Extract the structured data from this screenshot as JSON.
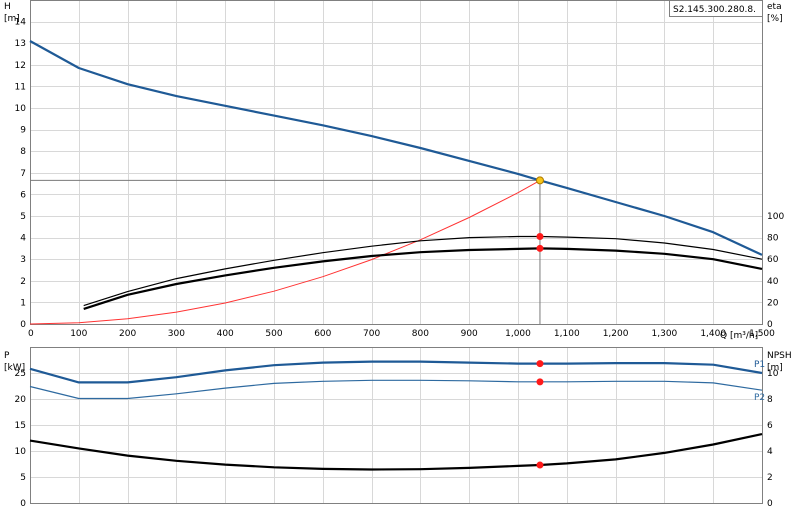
{
  "pump_id": "S2.145.300.280.8.",
  "colors": {
    "head": "#1f5a96",
    "efficiency": "#000000",
    "system_curve": "#ff3333",
    "duty_marker": "#ff1a1a",
    "duty_head_marker": "#f5c518",
    "p1": "#1f5a96",
    "p2": "#2e6aa0",
    "npsh": "#000000"
  },
  "chart_data": [
    {
      "type": "line",
      "ylabel_left": [
        "H",
        "[m]"
      ],
      "ylabel_right": [
        "eta",
        "[%]"
      ],
      "xlabel": "Q [m³/h]",
      "xlim": [
        0,
        1500
      ],
      "ylim": [
        0,
        15
      ],
      "xticks": [
        0,
        100,
        200,
        300,
        400,
        500,
        600,
        700,
        800,
        900,
        1000,
        1100,
        1200,
        1300,
        1400,
        1500
      ],
      "xtick_labels": [
        "0",
        "100",
        "200",
        "300",
        "400",
        "500",
        "600",
        "700",
        "800",
        "900",
        "1,000",
        "1,100",
        "1,200",
        "1,300",
        "1,400",
        "1,500"
      ],
      "yticks_left": [
        0,
        1,
        2,
        3,
        4,
        5,
        6,
        7,
        8,
        9,
        10,
        11,
        12,
        13,
        14
      ],
      "yticks_right": [
        0,
        20,
        40,
        60,
        80,
        100
      ],
      "right_axis_scale": 20,
      "grid": true,
      "duty_point": {
        "q": 1045,
        "h": 6.65
      },
      "series": [
        {
          "key": "head",
          "axis": "left",
          "width": 2.2,
          "x": [
            0,
            100,
            200,
            300,
            400,
            500,
            600,
            700,
            800,
            900,
            1000,
            1045,
            1100,
            1200,
            1300,
            1400,
            1500
          ],
          "y": [
            13.1,
            11.85,
            11.1,
            10.55,
            10.1,
            9.65,
            9.2,
            8.7,
            8.15,
            7.55,
            6.95,
            6.65,
            6.3,
            5.65,
            5.0,
            4.25,
            3.2
          ]
        },
        {
          "key": "system_curve",
          "axis": "left",
          "width": 1,
          "x": [
            0,
            100,
            200,
            300,
            400,
            500,
            600,
            700,
            800,
            900,
            1000,
            1045
          ],
          "y": [
            0,
            0.06,
            0.24,
            0.55,
            0.97,
            1.52,
            2.19,
            2.98,
            3.9,
            4.93,
            6.08,
            6.65
          ]
        },
        {
          "key": "eta_upper",
          "axis": "right",
          "width": 1.2,
          "x": [
            110,
            200,
            300,
            400,
            500,
            600,
            700,
            800,
            900,
            1000,
            1045,
            1100,
            1200,
            1300,
            1400,
            1500
          ],
          "y": [
            17,
            30,
            42,
            51,
            59,
            66,
            72,
            77,
            80,
            81,
            81,
            80.5,
            79,
            75,
            69,
            60
          ]
        },
        {
          "key": "eta_lower",
          "axis": "right",
          "width": 2.2,
          "x": [
            110,
            200,
            300,
            400,
            500,
            600,
            700,
            800,
            900,
            1000,
            1045,
            1100,
            1200,
            1300,
            1400,
            1500
          ],
          "y": [
            14,
            27,
            37,
            45,
            52,
            58,
            63,
            66.5,
            68.5,
            69.5,
            70,
            69.5,
            68,
            65,
            60,
            51
          ]
        }
      ],
      "markers": [
        {
          "key": "duty_head_marker",
          "axis": "left",
          "x": 1045,
          "y": 6.65,
          "r": 3.5
        },
        {
          "key": "duty_marker",
          "axis": "right",
          "x": 1045,
          "y": 81,
          "r": 3
        },
        {
          "key": "duty_marker",
          "axis": "right",
          "x": 1045,
          "y": 70,
          "r": 3
        }
      ]
    },
    {
      "type": "line",
      "ylabel_left": [
        "P",
        "[kW]"
      ],
      "ylabel_right": [
        "NPSH",
        "[m]"
      ],
      "xlim": [
        0,
        1500
      ],
      "ylim": [
        0,
        30
      ],
      "yticks_left": [
        0,
        5,
        10,
        15,
        20,
        25
      ],
      "yticks_right": [
        0,
        2,
        4,
        6,
        8,
        10
      ],
      "right_axis_scale": 0.4,
      "grid": true,
      "series": [
        {
          "key": "p1",
          "label": "P1",
          "axis": "left",
          "width": 2.2,
          "x": [
            0,
            100,
            200,
            300,
            400,
            500,
            600,
            700,
            800,
            900,
            1000,
            1045,
            1100,
            1200,
            1300,
            1400,
            1500
          ],
          "y": [
            25.8,
            23.2,
            23.2,
            24.2,
            25.5,
            26.5,
            27.0,
            27.2,
            27.2,
            27.0,
            26.8,
            26.8,
            26.8,
            26.9,
            26.9,
            26.6,
            25.0
          ]
        },
        {
          "key": "p2",
          "label": "P2",
          "axis": "left",
          "width": 1.2,
          "x": [
            0,
            100,
            200,
            300,
            400,
            500,
            600,
            700,
            800,
            900,
            1000,
            1045,
            1100,
            1200,
            1300,
            1400,
            1500
          ],
          "y": [
            22.4,
            20.1,
            20.1,
            21.0,
            22.1,
            23.0,
            23.4,
            23.6,
            23.6,
            23.5,
            23.3,
            23.3,
            23.3,
            23.4,
            23.4,
            23.1,
            21.7
          ]
        },
        {
          "key": "npsh",
          "axis": "right",
          "width": 2.2,
          "x": [
            0,
            100,
            200,
            300,
            400,
            500,
            600,
            700,
            800,
            900,
            1000,
            1045,
            1100,
            1200,
            1300,
            1400,
            1500
          ],
          "y": [
            4.8,
            4.2,
            3.65,
            3.25,
            2.95,
            2.75,
            2.62,
            2.58,
            2.6,
            2.7,
            2.85,
            2.92,
            3.05,
            3.35,
            3.85,
            4.5,
            5.3
          ]
        }
      ],
      "markers": [
        {
          "key": "duty_marker",
          "axis": "left",
          "x": 1045,
          "y": 26.8,
          "r": 3
        },
        {
          "key": "duty_marker",
          "axis": "left",
          "x": 1045,
          "y": 23.3,
          "r": 3
        },
        {
          "key": "duty_marker",
          "axis": "right",
          "x": 1045,
          "y": 2.92,
          "r": 3
        }
      ]
    }
  ]
}
